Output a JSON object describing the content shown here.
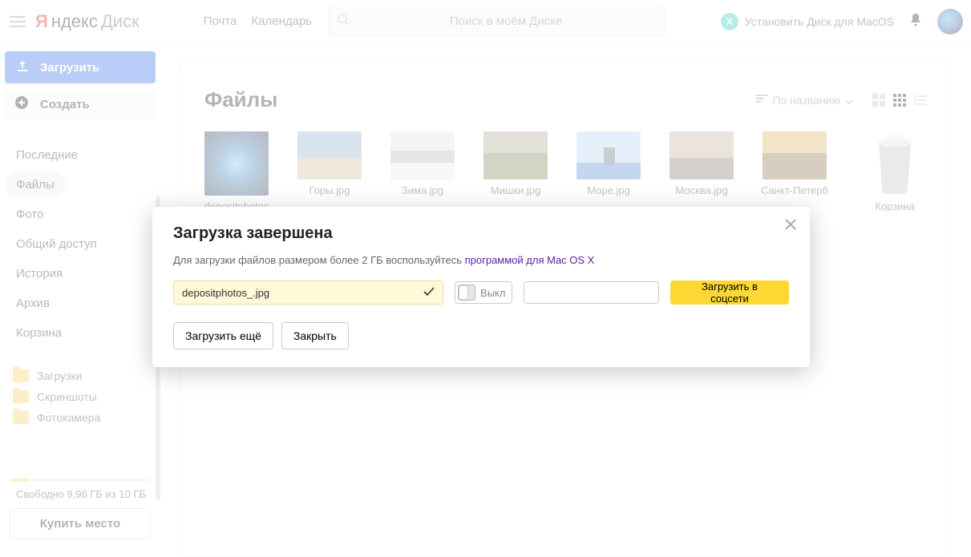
{
  "header": {
    "logo_y": "Я",
    "logo_name1": "ндекс",
    "logo_name2": "Диск",
    "mail": "Почта",
    "calendar": "Календарь",
    "search_placeholder": "Поиск в моём Диске",
    "install_badge": "X",
    "install_label": "Установить Диск для MacOS"
  },
  "sidebar": {
    "upload": "Загрузить",
    "create": "Создать",
    "nav": [
      "Последние",
      "Файлы",
      "Фото",
      "Общий доступ",
      "История",
      "Архив",
      "Корзина"
    ],
    "active_index": 1,
    "folders": [
      "Загрузки",
      "Скриншоты",
      "Фотокамера"
    ],
    "storage_text": "Свободно 9,96 ГБ из 10 ГБ",
    "buy": "Купить место"
  },
  "main": {
    "title": "Файлы",
    "sort_label": "По названию",
    "thumbs": [
      {
        "name": "depositphotos",
        "big": true,
        "css": "t-earth"
      },
      {
        "name": "Горы.jpg",
        "css": "t-mtns"
      },
      {
        "name": "Зима.jpg",
        "css": "t-winter"
      },
      {
        "name": "Мишки.jpg",
        "css": "t-bears"
      },
      {
        "name": "Море.jpg",
        "css": "t-sea"
      },
      {
        "name": "Москва.jpg",
        "css": "t-moscow"
      },
      {
        "name": "Санкт-Петерб",
        "css": "t-spb"
      }
    ],
    "trash_label": "Корзина"
  },
  "modal": {
    "title": "Загрузка завершена",
    "sub_pre": "Для загрузки файлов размером более 2 ГБ воспользуйтесь ",
    "sub_link": "программой для Mac OS X",
    "file_name": "depositphotos_.jpg",
    "toggle_label": "Выкл",
    "social_btn": "Загрузить в соцсети",
    "more_btn": "Загрузить ещё",
    "close_btn": "Закрыть"
  }
}
